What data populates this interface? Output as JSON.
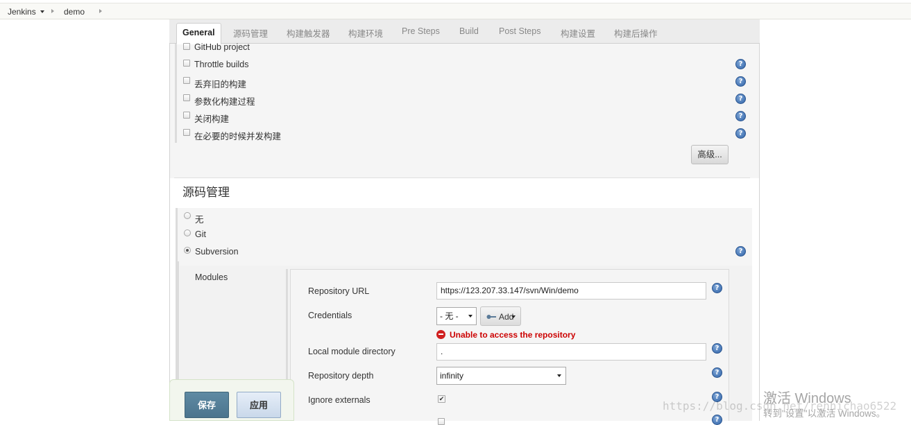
{
  "breadcrumb": {
    "root": "Jenkins",
    "job": "demo"
  },
  "tabs": [
    "General",
    "源码管理",
    "构建触发器",
    "构建环境",
    "Pre Steps",
    "Build",
    "Post Steps",
    "构建设置",
    "构建后操作"
  ],
  "general": {
    "options": [
      "GitHub project",
      "Throttle builds",
      "丢弃旧的构建",
      "参数化构建过程",
      "关闭构建",
      "在必要的时候并发构建"
    ],
    "advanced_button": "高级..."
  },
  "scm": {
    "title": "源码管理",
    "options": [
      "无",
      "Git",
      "Subversion"
    ],
    "selected": "Subversion",
    "modules_label": "Modules",
    "fields": {
      "repository_url_label": "Repository URL",
      "repository_url_value": "https://123.207.33.147/svn/Win/demo",
      "credentials_label": "Credentials",
      "credentials_value": "- 无 -",
      "add_button": "Add",
      "error": "Unable to access the repository",
      "local_dir_label": "Local module directory",
      "local_dir_value": ".",
      "depth_label": "Repository depth",
      "depth_value": "infinity",
      "ignore_externals_label": "Ignore externals",
      "ignore_externals_checked": true
    }
  },
  "footer": {
    "save": "保存",
    "apply": "应用"
  },
  "overlay": {
    "watermark": "https://blog.csdn.net/renhichao6522",
    "windows_line1": "激活 Windows",
    "windows_line2": "转到\"设置\"以激活 Windows。"
  },
  "colors": {
    "error": "#cc0000",
    "save_button": "#4e7690",
    "help_icon": "#2f63a8"
  }
}
